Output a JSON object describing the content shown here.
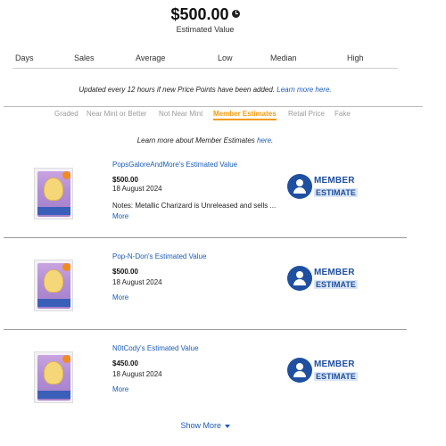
{
  "estimated_value": {
    "amount": "$500.00",
    "label": "Estimated Value"
  },
  "stats_columns": [
    "Days",
    "Sales",
    "Average",
    "Low",
    "Median",
    "High"
  ],
  "update_note": {
    "text": "Updated every 12 hours if new Price Points have been added. ",
    "link": "Learn more here."
  },
  "tabs": [
    {
      "label": "Graded",
      "active": false
    },
    {
      "label": "Near Mint or Better",
      "active": false
    },
    {
      "label": "Not Near Mint",
      "active": false
    },
    {
      "label": "Member Estimates",
      "active": true
    },
    {
      "label": "Retail Price",
      "active": false
    },
    {
      "label": "Fake",
      "active": false
    }
  ],
  "learn_member": {
    "text": "Learn more about Member Estimates ",
    "link": "here",
    "suffix": "."
  },
  "entries": [
    {
      "title": "PopsGaloreAndMore's Estimated Value",
      "price": "$500.00",
      "date": "18 August 2024",
      "notes": "Notes:  Metallic Charizard is Unreleased and sells ...",
      "more": "More",
      "badge_line1": "MEMBER",
      "badge_line2": "ESTIMATE"
    },
    {
      "title": "Pop-N-Don's Estimated Value",
      "price": "$500.00",
      "date": "18 August 2024",
      "notes": "",
      "more": "More",
      "badge_line1": "MEMBER",
      "badge_line2": "ESTIMATE"
    },
    {
      "title": "N0tCody's Estimated Value",
      "price": "$450.00",
      "date": "18 August 2024",
      "notes": "",
      "more": "More",
      "badge_line1": "MEMBER",
      "badge_line2": "ESTIMATE"
    }
  ],
  "show_more": "Show More",
  "colors": {
    "link": "#1a5bb8",
    "active_tab": "#f29b0f",
    "badge": "#1f4fa0"
  },
  "icons": {
    "value_info": "clock-icon",
    "show_more": "chevron-down-icon",
    "member": "member-estimate-icon"
  }
}
